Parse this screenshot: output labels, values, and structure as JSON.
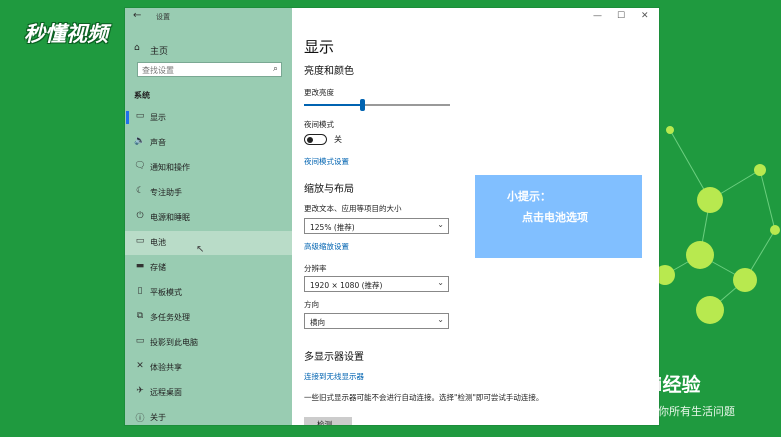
{
  "brand": {
    "logo_text": "秒懂视频",
    "baidu_text": "i经验",
    "baidu_sub": "你所有生活问题"
  },
  "window": {
    "title": "设置",
    "back_icon": "back-arrow-icon",
    "controls": [
      "—",
      "☐",
      "✕"
    ]
  },
  "sidebar": {
    "home_label": "主页",
    "search_placeholder": "查找设置",
    "section": "系统",
    "items": [
      {
        "icon": "display-icon",
        "glyph": "▭",
        "label": "显示",
        "selected": true
      },
      {
        "icon": "sound-icon",
        "glyph": "🔈",
        "label": "声音"
      },
      {
        "icon": "notification-icon",
        "glyph": "🗨",
        "label": "通知和操作"
      },
      {
        "icon": "focus-assist-icon",
        "glyph": "☾",
        "label": "专注助手"
      },
      {
        "icon": "power-icon",
        "glyph": "⏻",
        "label": "电源和睡眠"
      },
      {
        "icon": "battery-icon",
        "glyph": "▭",
        "label": "电池",
        "hover": true
      },
      {
        "icon": "storage-icon",
        "glyph": "▬",
        "label": "存储"
      },
      {
        "icon": "tablet-icon",
        "glyph": "▯",
        "label": "平板模式"
      },
      {
        "icon": "multitasking-icon",
        "glyph": "⧉",
        "label": "多任务处理"
      },
      {
        "icon": "projecting-icon",
        "glyph": "▭",
        "label": "投影到此电脑"
      },
      {
        "icon": "shared-experiences-icon",
        "glyph": "✕",
        "label": "体验共享"
      },
      {
        "icon": "remote-desktop-icon",
        "glyph": "✈",
        "label": "远程桌面"
      },
      {
        "icon": "about-icon",
        "glyph": "ⓘ",
        "label": "关于"
      }
    ]
  },
  "main": {
    "title": "显示",
    "brightness_section": "亮度和颜色",
    "brightness_label": "更改亮度",
    "brightness_value": 0.4,
    "night_mode_label": "夜间模式",
    "night_mode_state": "关",
    "night_mode_link": "夜间模式设置",
    "scale_section": "缩放与布局",
    "scale_label": "更改文本、应用等项目的大小",
    "scale_value": "125% (推荐)",
    "advanced_scale_link": "高级缩放设置",
    "resolution_label": "分辨率",
    "resolution_value": "1920 × 1080 (推荐)",
    "orientation_label": "方向",
    "orientation_value": "横向",
    "multi_display_section": "多显示器设置",
    "wireless_link": "连接到无线显示器",
    "multi_desc": "一些旧式显示器可能不会进行自动连接。选择\"检测\"即可尝试手动连接。",
    "detect_button": "检测"
  },
  "tip": {
    "title": "小提示：",
    "body": "点击电池选项",
    "color": "#81bfff"
  }
}
